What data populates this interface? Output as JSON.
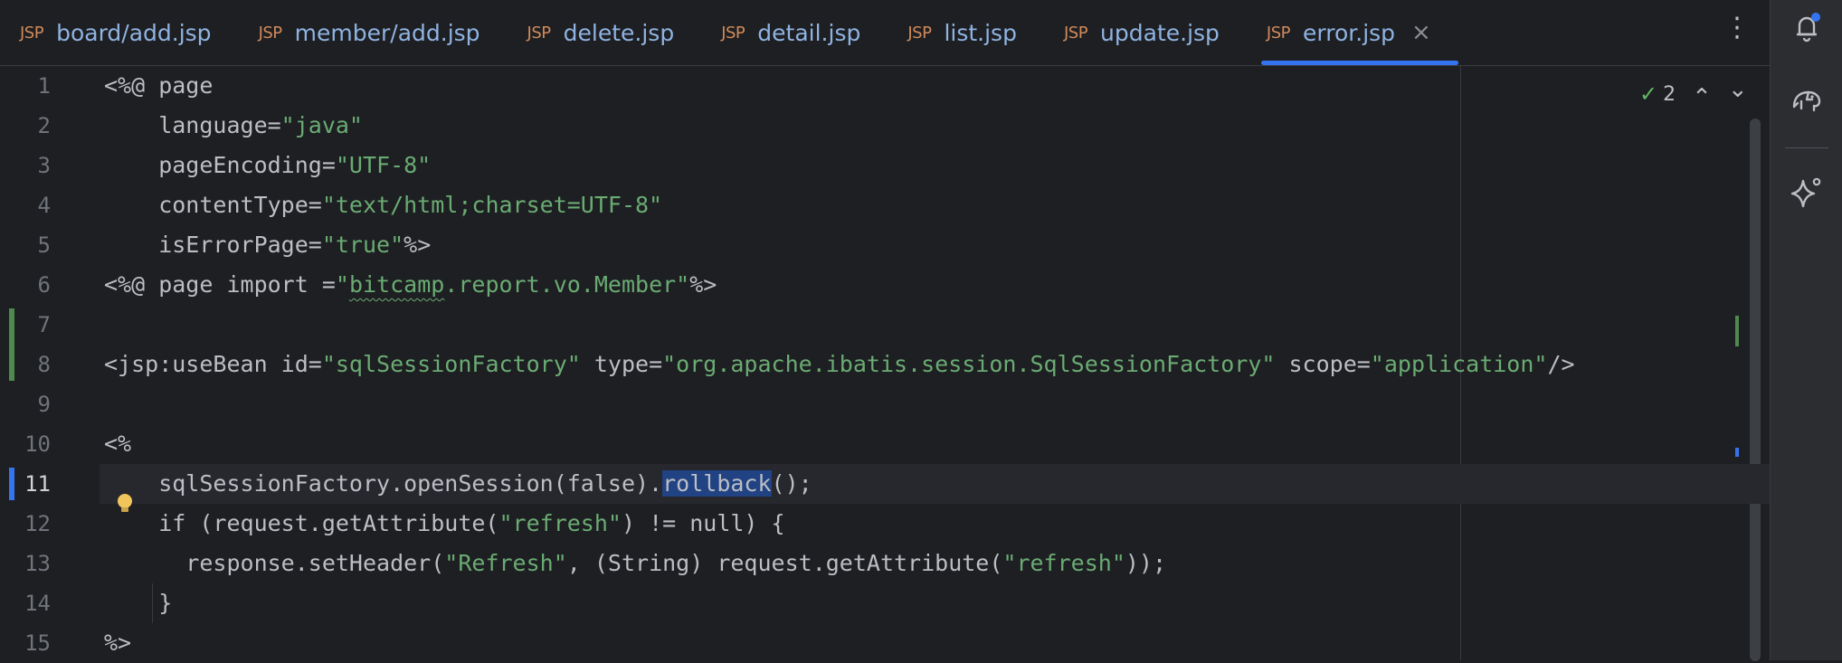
{
  "tabs": [
    {
      "badge": "JSP",
      "label": "board/add.jsp",
      "active": false
    },
    {
      "badge": "JSP",
      "label": "member/add.jsp",
      "active": false
    },
    {
      "badge": "JSP",
      "label": "delete.jsp",
      "active": false
    },
    {
      "badge": "JSP",
      "label": "detail.jsp",
      "active": false
    },
    {
      "badge": "JSP",
      "label": "list.jsp",
      "active": false
    },
    {
      "badge": "JSP",
      "label": "update.jsp",
      "active": false
    },
    {
      "badge": "JSP",
      "label": "error.jsp",
      "active": true
    }
  ],
  "tab_close_glyph": "×",
  "more_glyph": "⋮",
  "inspection": {
    "check_glyph": "✓",
    "count": "2",
    "up_glyph": "⌃",
    "down_glyph": "⌄"
  },
  "right_toolbar": {
    "icons": [
      "notification-bell-icon",
      "database-elephant-icon",
      "ai-assistant-sparkle-icon"
    ]
  },
  "colors": {
    "accent": "#3574f0",
    "string": "#6aab73",
    "modified": "#4e8a4e",
    "selection": "#214283",
    "badge": "#d08a5b"
  },
  "code": {
    "current_line": 11,
    "lines": [
      {
        "n": "1",
        "segments": [
          {
            "t": "<%@ page"
          }
        ]
      },
      {
        "n": "2",
        "segments": [
          {
            "t": "    language="
          },
          {
            "t": "\"java\"",
            "c": "str"
          }
        ]
      },
      {
        "n": "3",
        "segments": [
          {
            "t": "    pageEncoding="
          },
          {
            "t": "\"UTF-8\"",
            "c": "str"
          }
        ]
      },
      {
        "n": "4",
        "segments": [
          {
            "t": "    contentType="
          },
          {
            "t": "\"text/html;charset=UTF-8\"",
            "c": "str"
          }
        ]
      },
      {
        "n": "5",
        "segments": [
          {
            "t": "    isErrorPage="
          },
          {
            "t": "\"true\"",
            "c": "str"
          },
          {
            "t": "%>"
          }
        ]
      },
      {
        "n": "6",
        "segments": [
          {
            "t": "<%@ page import ="
          },
          {
            "t": "\"",
            "c": "str"
          },
          {
            "t": "bitcamp",
            "c": "str-wavy"
          },
          {
            "t": ".report.vo.Member\"",
            "c": "str"
          },
          {
            "t": "%>"
          }
        ]
      },
      {
        "n": "7",
        "segments": []
      },
      {
        "n": "8",
        "segments": [
          {
            "t": "<jsp:useBean id="
          },
          {
            "t": "\"sqlSessionFactory\"",
            "c": "str"
          },
          {
            "t": " type="
          },
          {
            "t": "\"org.apache.ibatis.session.SqlSessionFactory\"",
            "c": "str"
          },
          {
            "t": " scope="
          },
          {
            "t": "\"application\"",
            "c": "str"
          },
          {
            "t": "/>"
          }
        ]
      },
      {
        "n": "9",
        "segments": []
      },
      {
        "n": "10",
        "segments": [
          {
            "t": "<%"
          }
        ]
      },
      {
        "n": "11",
        "segments": [
          {
            "t": "    sqlSessionFactory.openSession(false)."
          },
          {
            "t": "rollback",
            "c": "sel"
          },
          {
            "t": "();"
          }
        ]
      },
      {
        "n": "12",
        "segments": [
          {
            "t": "    if (request.getAttribute("
          },
          {
            "t": "\"refresh\"",
            "c": "str"
          },
          {
            "t": ") != null) {"
          }
        ]
      },
      {
        "n": "13",
        "segments": [
          {
            "t": "      response.setHeader("
          },
          {
            "t": "\"Refresh\"",
            "c": "str"
          },
          {
            "t": ", (String) request.getAttribute("
          },
          {
            "t": "\"refresh\"",
            "c": "str"
          },
          {
            "t": "));"
          }
        ]
      },
      {
        "n": "14",
        "segments": [
          {
            "t": "    }"
          }
        ]
      },
      {
        "n": "15",
        "segments": [
          {
            "t": "%>"
          }
        ]
      }
    ]
  }
}
